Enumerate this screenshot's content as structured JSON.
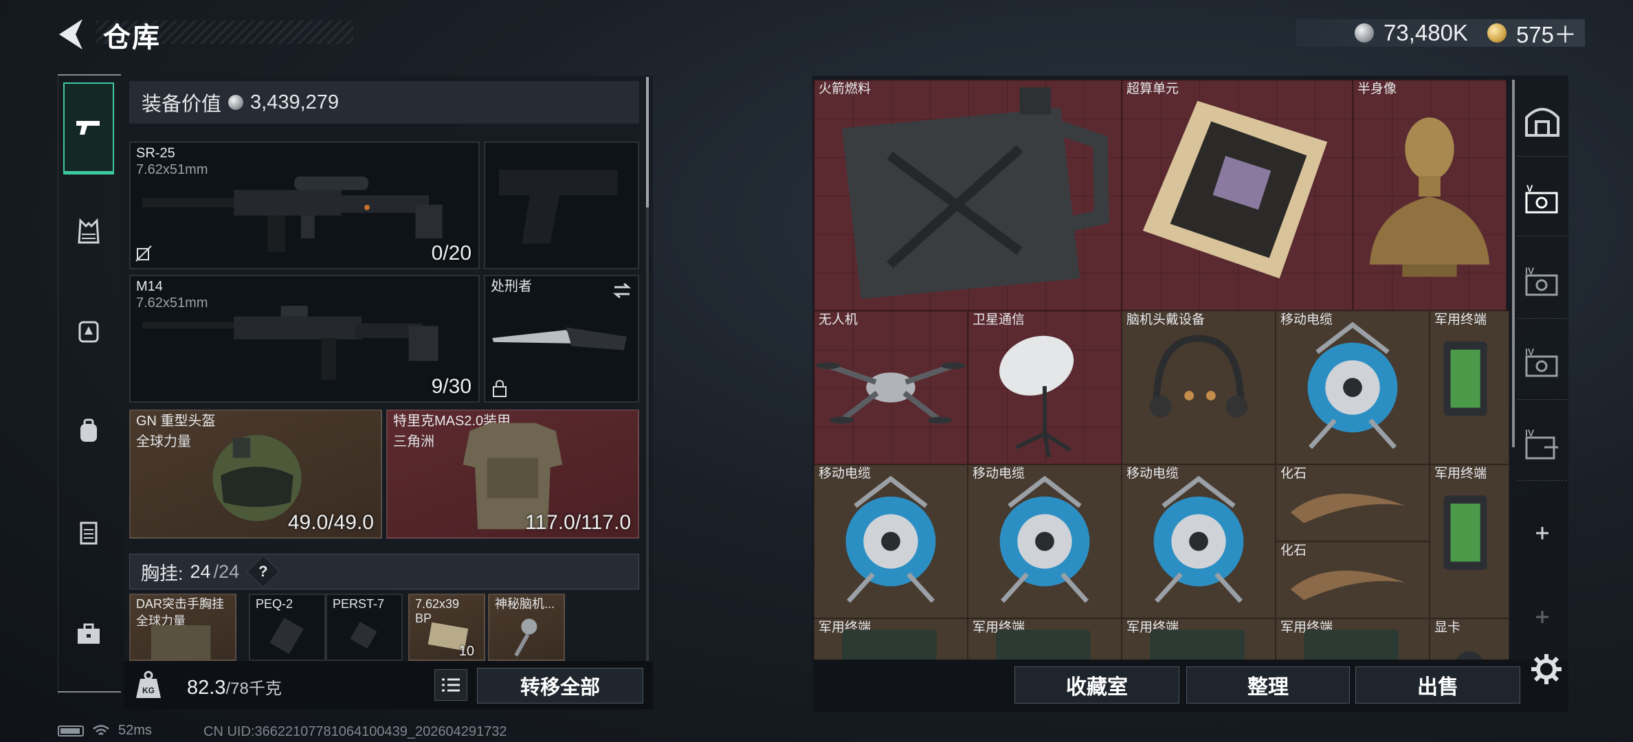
{
  "header": {
    "title": "仓库",
    "currencies": [
      {
        "icon": "silver-coin-icon",
        "value": "73,480K"
      },
      {
        "icon": "gold-coin-icon",
        "value": "575＋"
      }
    ]
  },
  "sidebar": {
    "items": [
      {
        "icon": "pistol-icon",
        "active": true
      },
      {
        "icon": "vest-icon",
        "active": false
      },
      {
        "icon": "backpack-warning-icon",
        "active": false
      },
      {
        "icon": "backpack-icon",
        "active": false
      },
      {
        "icon": "clipboard-icon",
        "active": false
      },
      {
        "icon": "briefcase-icon",
        "active": false
      }
    ]
  },
  "loadout": {
    "value_label": "装备价值",
    "value": "3,439,279",
    "primary": {
      "name": "SR-25",
      "caliber": "7.62x51mm",
      "ammo": "0/20"
    },
    "secondary": {
      "name": "M14",
      "caliber": "7.62x51mm",
      "ammo": "9/30"
    },
    "melee": {
      "name": "处刑者"
    },
    "helmet": {
      "name": "GN 重型头盔",
      "sub": "全球力量",
      "durability": "49.0/49.0"
    },
    "armor": {
      "name": "特里克MAS2.0装甲",
      "sub": "三角洲",
      "durability": "117.0/117.0"
    },
    "chest_rig": {
      "label": "胸挂:",
      "current": "24",
      "max": "/24",
      "help": "?"
    },
    "chest_items": [
      {
        "name": "DAR突击手胸挂",
        "sub": "全球力量"
      },
      {
        "name": "PEQ-2"
      },
      {
        "name": "PERST-7"
      },
      {
        "name": "7.62x39",
        "sub": "BP",
        "count": "10"
      },
      {
        "name": "神秘脑机..."
      }
    ]
  },
  "footer_left": {
    "weight": "82.3",
    "weight_max": "/78千克",
    "transfer_all": "转移全部"
  },
  "storage": {
    "items": [
      {
        "name": "火箭燃料",
        "color": "red"
      },
      {
        "name": "超算单元",
        "color": "red"
      },
      {
        "name": "半身像",
        "color": "red"
      },
      {
        "name": "无人机",
        "color": "red"
      },
      {
        "name": "卫星通信",
        "color": "red"
      },
      {
        "name": "脑机头戴设备",
        "color": "brown"
      },
      {
        "name": "移动电缆",
        "color": "brown"
      },
      {
        "name": "军用终端",
        "color": "brown"
      },
      {
        "name": "移动电缆",
        "color": "brown"
      },
      {
        "name": "移动电缆",
        "color": "brown"
      },
      {
        "name": "移动电缆",
        "color": "brown"
      },
      {
        "name": "化石",
        "color": "brown"
      },
      {
        "name": "化石",
        "color": "brown"
      },
      {
        "name": "军用终端",
        "color": "brown"
      },
      {
        "name": "军用终端",
        "color": "brown"
      },
      {
        "name": "军用终端",
        "color": "brown"
      },
      {
        "name": "军用终端",
        "color": "brown"
      },
      {
        "name": "军用终端",
        "color": "brown"
      },
      {
        "name": "显卡",
        "color": "brown"
      }
    ],
    "buttons": {
      "collection": "收藏室",
      "sort": "整理",
      "sell": "出售"
    },
    "side_tabs": [
      "V",
      "IV",
      "IV",
      "IV"
    ]
  },
  "status": {
    "ping": "52ms",
    "uid": "CN UID:366221077810641004​39_202604291732"
  }
}
